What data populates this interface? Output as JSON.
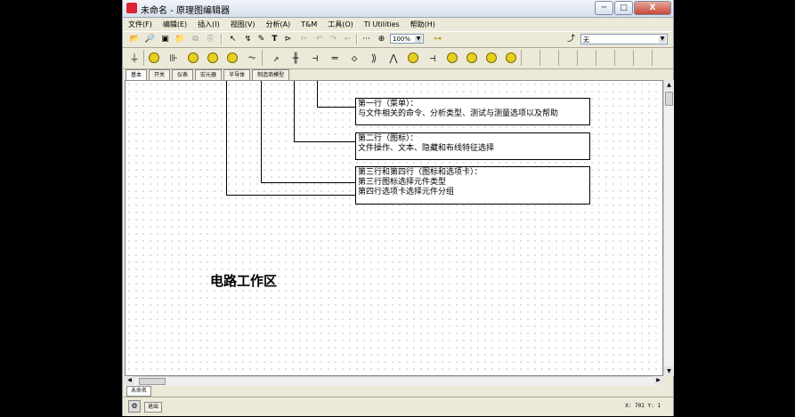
{
  "window": {
    "title": "未命名 - 原理图编辑器",
    "buttons": [
      "─",
      "□",
      "X"
    ]
  },
  "menu": [
    "文件(F)",
    "编辑(E)",
    "插入(I)",
    "视图(V)",
    "分析(A)",
    "T&M",
    "工具(O)",
    "TI Utilities",
    "帮助(H)"
  ],
  "toolbar": {
    "zoom_value": "100%",
    "net_value": "无"
  },
  "component_tabs": [
    "基本",
    "开关",
    "仪表",
    "宏元器",
    "半导体",
    "制造商模型"
  ],
  "callouts": [
    {
      "lines": [
        "第一行（菜单）：",
        "与文件相关的命令、分析类型、测试与测量选项以及帮助"
      ]
    },
    {
      "lines": [
        "第二行（图标）：",
        "文件操作、文本、隐藏和布线特征选择"
      ]
    },
    {
      "lines": [
        "第三行和第四行（图标和选项卡）：",
        "第三行图标选择元件类型",
        "第四行选项卡选择元件分组"
      ]
    }
  ],
  "workarea_label": "电路工作区",
  "sheet_tab": "未命名",
  "status": {
    "exit_label": "退出",
    "coords": "X: 701  Y: 1"
  },
  "icons": {
    "file_toolbar": [
      "open-folder-icon",
      "find-icon",
      "save-icon",
      "open-icon",
      "copy-icon",
      "paste-icon"
    ],
    "edit_toolbar": [
      "select-pointer-icon",
      "wire-pointer-icon",
      "pen-icon",
      "text-icon",
      "probe-icon",
      "cut-icon",
      "undo-icon",
      "redo-icon",
      "back-icon"
    ],
    "component_toolbar": [
      "ground-icon",
      "voltage-source-icon",
      "battery-icon",
      "current-source-icon",
      "ac-source-icon",
      "sine-source-icon",
      "resistor-icon",
      "variable-resistor-icon",
      "capacitor-icon",
      "polarized-capacitor-icon",
      "electrolytic-capacitor-icon",
      "inductor-icon",
      "transformer-icon",
      "diode-icon",
      "led-icon",
      "switch-icon",
      "meter-a-icon",
      "meter-v-icon",
      "meter-w-icon",
      "meter-probe-icon"
    ]
  }
}
